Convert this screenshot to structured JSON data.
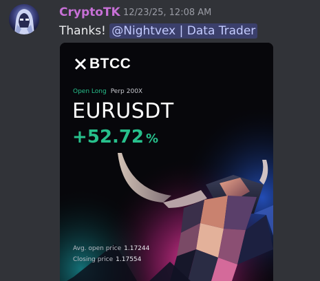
{
  "message": {
    "username": "CryptoTK",
    "timestamp": "12/23/25, 12:08 AM",
    "text": "Thanks! ",
    "mention": "@Nightvex | Data Trader"
  },
  "card": {
    "brand": "BTCC",
    "position_type": "Open Long",
    "contract": "Perp",
    "leverage": "200X",
    "pair": "EURUSDT",
    "pnl_value": "+52.72",
    "pnl_unit": "%",
    "avg_open_label": "Avg. open price",
    "avg_open_value": "1.17244",
    "closing_label": "Closing price",
    "closing_value": "1.17554"
  },
  "colors": {
    "username": "#c770d6",
    "profit": "#27c08c",
    "mention_bg": "#3b3f6b",
    "mention_text": "#c3cbff",
    "background": "#313338"
  },
  "icons": {
    "avatar": "hooded-robot-avatar",
    "brand_logo": "btcc-x-logo",
    "artwork": "geometric-bull-artwork"
  }
}
